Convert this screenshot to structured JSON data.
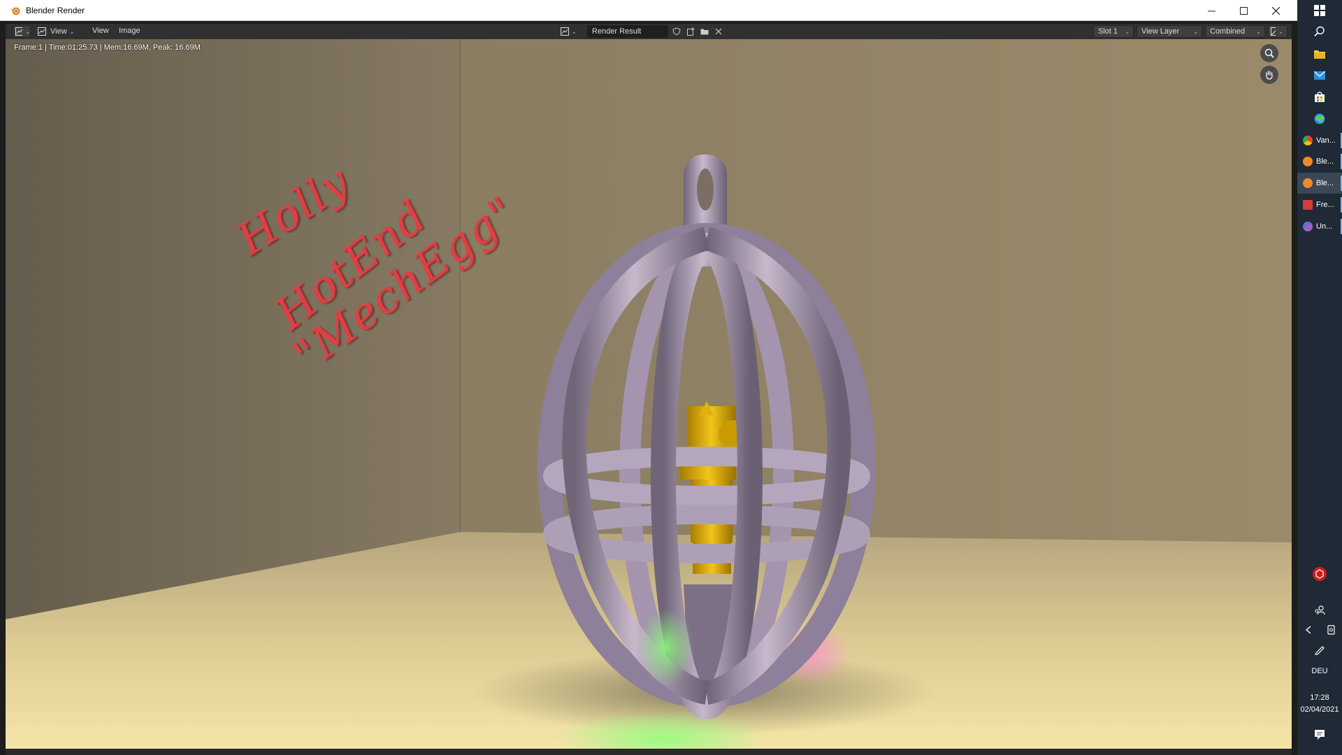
{
  "window": {
    "title": "Blender Render"
  },
  "header": {
    "view_menu": "View",
    "menu_view": "View",
    "menu_image": "Image",
    "image_name": "Render Result",
    "slot": "Slot 1",
    "view_layer": "View Layer",
    "pass": "Combined"
  },
  "status": {
    "info": "Frame:1 | Time:01:25.73 | Mem:16.69M, Peak: 16.69M"
  },
  "render_text": {
    "line1": "Holly",
    "line2": "HotEnd",
    "line3": "\"MechEgg\""
  },
  "taskbar": {
    "apps": [
      {
        "label": "Van...",
        "icon": "chrome-icon",
        "color": "#e8a33a"
      },
      {
        "label": "Ble...",
        "icon": "blender-icon",
        "color": "#f08a24"
      },
      {
        "label": "Ble...",
        "icon": "blender-icon",
        "color": "#f08a24"
      },
      {
        "label": "Fre...",
        "icon": "freecad-icon",
        "color": "#d63b3b"
      },
      {
        "label": "Un...",
        "icon": "ultimaker-cura-icon",
        "color": "#3d7bd9"
      }
    ],
    "language": "DEU",
    "time": "17:28",
    "date": "02/04/2021"
  }
}
